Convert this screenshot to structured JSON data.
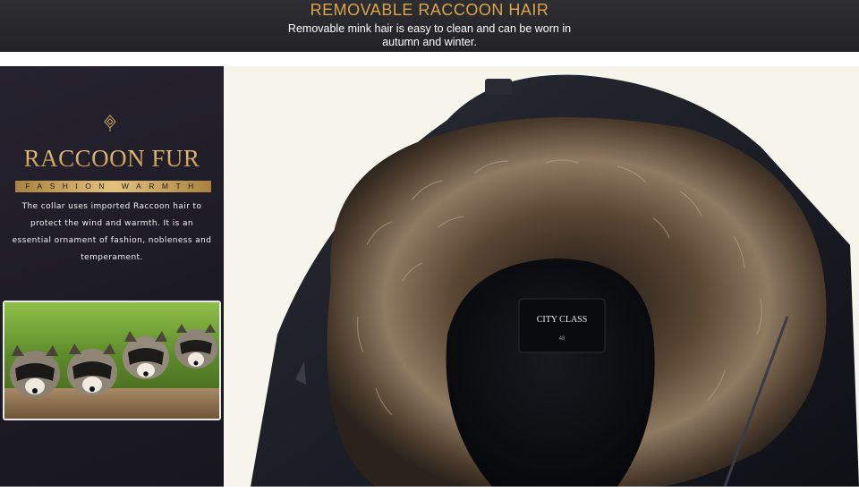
{
  "header": {
    "title": "REMOVABLE RACCOON HAIR",
    "subtitle": "Removable mink hair is easy to clean and can be worn in autumn and winter."
  },
  "sidebar": {
    "icon": "diamond-ornament-icon",
    "title": "RACCOON FUR",
    "tagline": "FASHION WARMTH",
    "description": "The collar uses imported Raccoon hair to protect the wind and warmth. It is an essential ornament of fashion, nobleness and temperament."
  },
  "photo": {
    "label_brand": "CITY CLASS",
    "label_size": "48"
  },
  "colors": {
    "header_bg": "#2a2a2e",
    "gold": "#d9a547",
    "sidebar_bg": "#1f1c26",
    "coat": "#15161c"
  }
}
